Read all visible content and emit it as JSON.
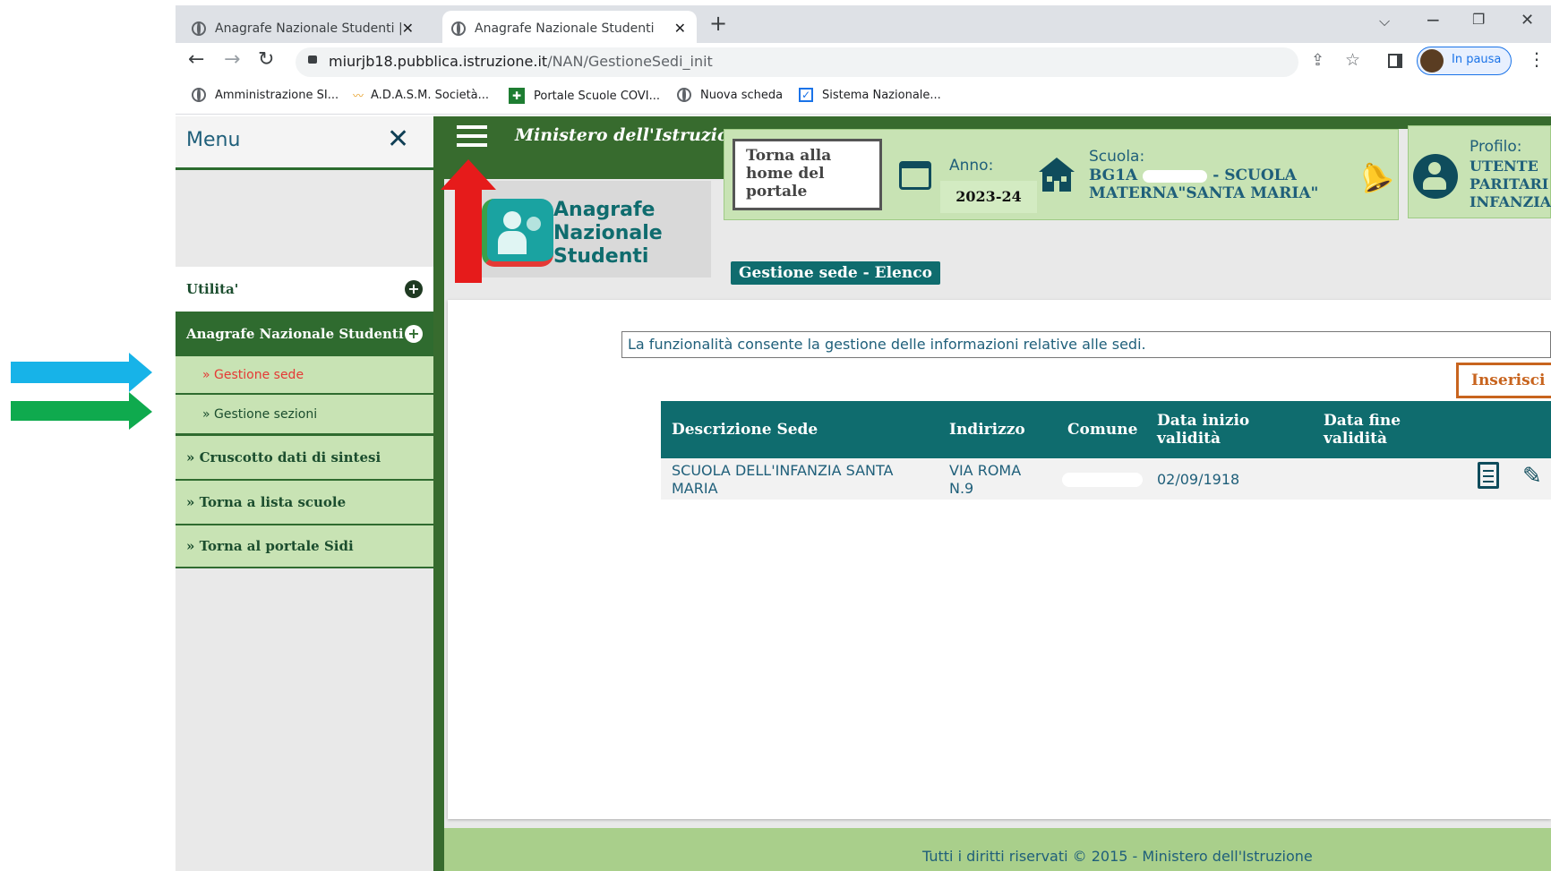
{
  "browser": {
    "tabs": [
      {
        "title": "Anagrafe Nazionale Studenti | Sc"
      },
      {
        "title": "Anagrafe Nazionale Studenti |"
      }
    ],
    "new_tab": "+",
    "url_domain": "miurjb18.pubblica.istruzione.it",
    "url_path": "/NAN/GestioneSedi_init",
    "profile_label": "In pausa",
    "bookmarks": [
      {
        "label": "Amministrazione SI...",
        "icon": "globe-icon"
      },
      {
        "label": "A.D.A.S.M. Società...",
        "icon": "chart-icon"
      },
      {
        "label": "Portale Scuole COVI...",
        "icon": "puzzle-icon"
      },
      {
        "label": "Nuova scheda",
        "icon": "globe-icon"
      },
      {
        "label": "Sistema Nazionale...",
        "icon": "check-icon"
      }
    ]
  },
  "sidebar": {
    "title": "Menu",
    "items": [
      {
        "label": "Utilita'"
      },
      {
        "label": "Anagrafe Nazionale Studenti"
      },
      {
        "label": "» Gestione sede"
      },
      {
        "label": "» Gestione sezioni"
      },
      {
        "label": "» Cruscotto dati di sintesi"
      },
      {
        "label": "» Torna a lista scuole"
      },
      {
        "label": "» Torna al portale Sidi"
      }
    ]
  },
  "header": {
    "ministry": "Ministero dell'Istruzione",
    "home_button": "Torna alla home del portale",
    "anno_label": "Anno:",
    "anno_value": "2023-24",
    "scuola_label": "Scuola:",
    "scuola_code": "BG1A",
    "scuola_name_line1": "- SCUOLA",
    "scuola_name_line2": "MATERNA\"SANTA MARIA\"",
    "profilo_label": "Profilo:",
    "profilo_lines": [
      "UTENTE",
      "PARITARI",
      "INFANZIA"
    ],
    "logo_text": [
      "Anagrafe",
      "Nazionale",
      "Studenti"
    ]
  },
  "page": {
    "title": "Gestione sede - Elenco",
    "info": "La funzionalità consente la gestione delle informazioni relative alle sedi.",
    "insert_button": "Inserisci s",
    "table": {
      "columns": [
        "Descrizione Sede",
        "Indirizzo",
        "Comune",
        "Data inizio validità",
        "Data fine validità"
      ],
      "rows": [
        {
          "descrizione": "SCUOLA DELL'INFANZIA SANTA MARIA",
          "indirizzo": "VIA ROMA N.9",
          "comune": "",
          "data_inizio": "02/09/1918",
          "data_fine": ""
        }
      ]
    }
  },
  "footer": {
    "text": "Tutti i diritti riservati © 2015 -  Ministero dell'Istruzione"
  },
  "colors": {
    "dark_green": "#376b2e",
    "teal": "#0f6c6e",
    "light_green": "#c8e3b4",
    "footer_green": "#a9cf8b",
    "active_link": "#e53935",
    "orange": "#c8641e",
    "arrow_blue": "#17b3e8",
    "arrow_green": "#0faa4e",
    "arrow_red": "#e61b1b"
  }
}
